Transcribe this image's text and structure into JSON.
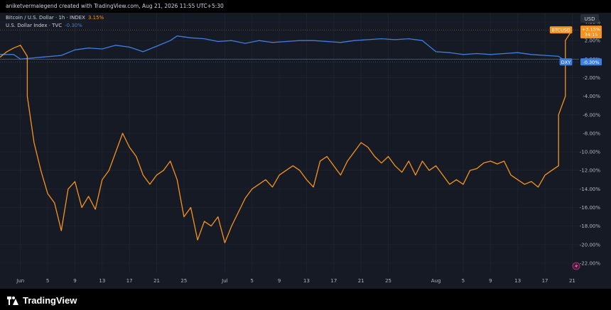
{
  "header": {
    "attribution": "aniketvermalegend created with TradingView.com, Aug 21, 2026 11:55 UTC+5:30"
  },
  "legend": {
    "btc_name": "Bitcoin / U.S. Dollar · 1h · INDEX",
    "btc_value": "3.15%",
    "dxy_name": "U.S. Dollar Index · TVC",
    "dxy_value": "-0.30%"
  },
  "axis": {
    "currency": "USD"
  },
  "footer": {
    "brand": "TradingView"
  },
  "colors": {
    "btc": "#f7931a",
    "dxy": "#3d7fe0",
    "background": "#161a25",
    "text": "#d1d4dc"
  },
  "icons": [
    "tradingview-logo-icon",
    "lightning-icon"
  ],
  "chart_data": {
    "type": "line",
    "y_unit": "%",
    "ylim": [
      -23,
      5
    ],
    "ticks": {
      "y": [
        "4.00%",
        "2.00%",
        "0.00%",
        "-2.00%",
        "-4.00%",
        "-6.00%",
        "-8.00%",
        "-10.00%",
        "-12.00%",
        "-14.00%",
        "-16.00%",
        "-18.00%",
        "-20.00%",
        "-22.00%"
      ],
      "x": [
        "Jun",
        "5",
        "9",
        "13",
        "17",
        "21",
        "25",
        "Jul",
        "5",
        "9",
        "13",
        "17",
        "21",
        "25",
        "Aug",
        "5",
        "9",
        "13",
        "17",
        "21"
      ]
    },
    "xlim": [
      "2026-05-29",
      "2026-08-22"
    ],
    "tick_dates": [
      "2026-06-01",
      "2026-06-05",
      "2026-06-09",
      "2026-06-13",
      "2026-06-17",
      "2026-06-21",
      "2026-06-25",
      "2026-07-01",
      "2026-07-05",
      "2026-07-09",
      "2026-07-13",
      "2026-07-17",
      "2026-07-21",
      "2026-07-25",
      "2026-08-01",
      "2026-08-05",
      "2026-08-09",
      "2026-08-13",
      "2026-08-17",
      "2026-08-21"
    ],
    "series": [
      {
        "name": "BTCUSD",
        "last_label": "+3.15%",
        "sub_label": "34:15",
        "color": "#f7931a",
        "points": [
          [
            "2026-05-29",
            0.2
          ],
          [
            "2026-05-30",
            0.8
          ],
          [
            "2026-05-31",
            1.2
          ],
          [
            "2026-06-01",
            1.5
          ],
          [
            "2026-06-02",
            0.3
          ],
          [
            "2026-06-02",
            -4.0
          ],
          [
            "2026-06-03",
            -9.0
          ],
          [
            "2026-06-04",
            -12.0
          ],
          [
            "2026-06-05",
            -14.5
          ],
          [
            "2026-06-06",
            -15.5
          ],
          [
            "2026-06-07",
            -18.5
          ],
          [
            "2026-06-08",
            -14.0
          ],
          [
            "2026-06-09",
            -13.2
          ],
          [
            "2026-06-10",
            -16.0
          ],
          [
            "2026-06-11",
            -14.8
          ],
          [
            "2026-06-12",
            -16.2
          ],
          [
            "2026-06-13",
            -13.0
          ],
          [
            "2026-06-14",
            -12.0
          ],
          [
            "2026-06-15",
            -10.0
          ],
          [
            "2026-06-16",
            -8.0
          ],
          [
            "2026-06-17",
            -9.5
          ],
          [
            "2026-06-18",
            -10.5
          ],
          [
            "2026-06-19",
            -12.5
          ],
          [
            "2026-06-20",
            -13.5
          ],
          [
            "2026-06-21",
            -12.5
          ],
          [
            "2026-06-22",
            -12.0
          ],
          [
            "2026-06-23",
            -11.0
          ],
          [
            "2026-06-24",
            -13.0
          ],
          [
            "2026-06-25",
            -17.0
          ],
          [
            "2026-06-26",
            -16.0
          ],
          [
            "2026-06-27",
            -19.5
          ],
          [
            "2026-06-28",
            -17.5
          ],
          [
            "2026-06-29",
            -18.0
          ],
          [
            "2026-06-30",
            -17.0
          ],
          [
            "2026-07-01",
            -19.8
          ],
          [
            "2026-07-02",
            -18.0
          ],
          [
            "2026-07-03",
            -16.5
          ],
          [
            "2026-07-04",
            -15.0
          ],
          [
            "2026-07-05",
            -14.0
          ],
          [
            "2026-07-06",
            -13.5
          ],
          [
            "2026-07-07",
            -13.0
          ],
          [
            "2026-07-08",
            -13.8
          ],
          [
            "2026-07-09",
            -12.5
          ],
          [
            "2026-07-10",
            -12.0
          ],
          [
            "2026-07-11",
            -11.5
          ],
          [
            "2026-07-12",
            -12.0
          ],
          [
            "2026-07-13",
            -13.0
          ],
          [
            "2026-07-14",
            -13.8
          ],
          [
            "2026-07-15",
            -11.0
          ],
          [
            "2026-07-16",
            -10.5
          ],
          [
            "2026-07-17",
            -11.5
          ],
          [
            "2026-07-18",
            -12.5
          ],
          [
            "2026-07-19",
            -11.0
          ],
          [
            "2026-07-20",
            -10.0
          ],
          [
            "2026-07-21",
            -9.0
          ],
          [
            "2026-07-22",
            -9.5
          ],
          [
            "2026-07-23",
            -10.5
          ],
          [
            "2026-07-24",
            -11.2
          ],
          [
            "2026-07-25",
            -10.5
          ],
          [
            "2026-07-26",
            -11.5
          ],
          [
            "2026-07-27",
            -12.2
          ],
          [
            "2026-07-28",
            -11.0
          ],
          [
            "2026-07-29",
            -12.5
          ],
          [
            "2026-07-30",
            -11.0
          ],
          [
            "2026-07-31",
            -12.0
          ],
          [
            "2026-08-01",
            -11.5
          ],
          [
            "2026-08-02",
            -12.5
          ],
          [
            "2026-08-03",
            -13.5
          ],
          [
            "2026-08-04",
            -13.0
          ],
          [
            "2026-08-05",
            -13.5
          ],
          [
            "2026-08-06",
            -12.0
          ],
          [
            "2026-08-07",
            -11.8
          ],
          [
            "2026-08-08",
            -11.2
          ],
          [
            "2026-08-09",
            -11.0
          ],
          [
            "2026-08-10",
            -11.3
          ],
          [
            "2026-08-11",
            -11.0
          ],
          [
            "2026-08-12",
            -12.5
          ],
          [
            "2026-08-13",
            -13.0
          ],
          [
            "2026-08-14",
            -13.5
          ],
          [
            "2026-08-15",
            -13.2
          ],
          [
            "2026-08-16",
            -13.8
          ],
          [
            "2026-08-17",
            -12.5
          ],
          [
            "2026-08-18",
            -12.0
          ],
          [
            "2026-08-19",
            -11.5
          ],
          [
            "2026-08-19",
            -6.0
          ],
          [
            "2026-08-20",
            -4.0
          ],
          [
            "2026-08-20",
            0.0
          ],
          [
            "2026-08-20",
            2.0
          ],
          [
            "2026-08-21",
            3.15
          ]
        ]
      },
      {
        "name": "DXY",
        "last_label": "-0.30%",
        "color": "#3d7fe0",
        "points": [
          [
            "2026-05-29",
            0.5
          ],
          [
            "2026-05-31",
            0.5
          ],
          [
            "2026-06-01",
            0.0
          ],
          [
            "2026-06-04",
            0.2
          ],
          [
            "2026-06-07",
            0.4
          ],
          [
            "2026-06-09",
            1.0
          ],
          [
            "2026-06-11",
            1.2
          ],
          [
            "2026-06-13",
            1.1
          ],
          [
            "2026-06-15",
            1.5
          ],
          [
            "2026-06-17",
            1.3
          ],
          [
            "2026-06-19",
            0.8
          ],
          [
            "2026-06-21",
            1.4
          ],
          [
            "2026-06-23",
            2.0
          ],
          [
            "2026-06-24",
            2.5
          ],
          [
            "2026-06-26",
            2.3
          ],
          [
            "2026-06-28",
            2.2
          ],
          [
            "2026-06-30",
            1.9
          ],
          [
            "2026-07-02",
            2.0
          ],
          [
            "2026-07-04",
            1.7
          ],
          [
            "2026-07-06",
            2.0
          ],
          [
            "2026-07-08",
            1.8
          ],
          [
            "2026-07-10",
            1.9
          ],
          [
            "2026-07-12",
            2.0
          ],
          [
            "2026-07-14",
            2.0
          ],
          [
            "2026-07-16",
            1.9
          ],
          [
            "2026-07-18",
            1.8
          ],
          [
            "2026-07-20",
            2.0
          ],
          [
            "2026-07-22",
            2.1
          ],
          [
            "2026-07-24",
            2.2
          ],
          [
            "2026-07-26",
            2.1
          ],
          [
            "2026-07-28",
            2.2
          ],
          [
            "2026-07-30",
            2.0
          ],
          [
            "2026-08-01",
            0.8
          ],
          [
            "2026-08-03",
            0.7
          ],
          [
            "2026-08-05",
            0.5
          ],
          [
            "2026-08-07",
            0.6
          ],
          [
            "2026-08-09",
            0.5
          ],
          [
            "2026-08-11",
            0.6
          ],
          [
            "2026-08-13",
            0.7
          ],
          [
            "2026-08-15",
            0.5
          ],
          [
            "2026-08-17",
            0.4
          ],
          [
            "2026-08-19",
            0.3
          ],
          [
            "2026-08-20",
            -0.2
          ],
          [
            "2026-08-21",
            -0.3
          ]
        ]
      }
    ]
  }
}
